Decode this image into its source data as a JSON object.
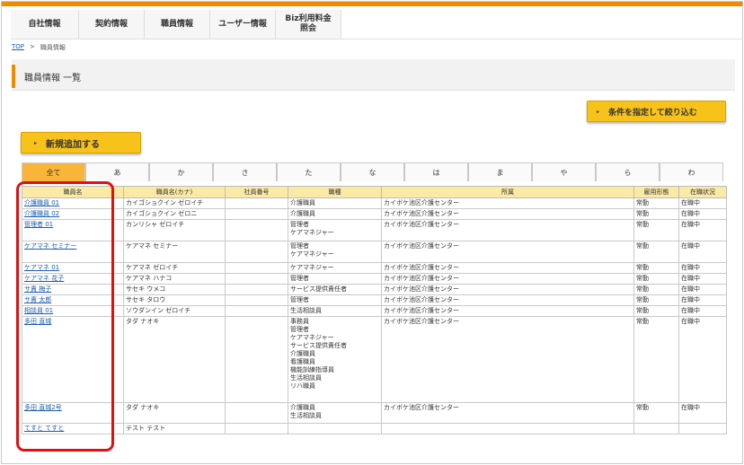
{
  "nav": {
    "tabs": [
      {
        "label": "自社情報"
      },
      {
        "label": "契約情報"
      },
      {
        "label": "職員情報"
      },
      {
        "label": "ユーザー情報"
      },
      {
        "label": "Biz利用料金\n照会"
      }
    ]
  },
  "breadcrumb": {
    "top": "TOP",
    "separator": ">",
    "current": "職員情報"
  },
  "page": {
    "title": "職員情報 一覧"
  },
  "buttons": {
    "filter": "条件を指定して絞り込む",
    "add": "新規追加する"
  },
  "kana_tabs": [
    "全て",
    "あ",
    "か",
    "さ",
    "た",
    "な",
    "は",
    "ま",
    "や",
    "ら",
    "わ"
  ],
  "table": {
    "headers": [
      "職員名",
      "職員名(カナ)",
      "社員番号",
      "職種",
      "所属",
      "雇用形態",
      "在職状況"
    ],
    "rows": [
      {
        "name": "介護職員 01",
        "kana": "カイゴショクイン ゼロイチ",
        "no": "",
        "jobs": [
          "介護職員"
        ],
        "dept": "カイボケ池区介護センター",
        "emp": "常勤",
        "status": "在職中"
      },
      {
        "name": "介護職員 02",
        "kana": "カイゴショクイン ゼロニ",
        "no": "",
        "jobs": [
          "介護職員"
        ],
        "dept": "カイボケ池区介護センター",
        "emp": "常勤",
        "status": "在職中"
      },
      {
        "name": "管理者 01",
        "kana": "カンリシャ ゼロイチ",
        "no": "",
        "jobs": [
          "管理者",
          "ケアマネジャー"
        ],
        "dept": "カイボケ池区介護センター",
        "emp": "常勤",
        "status": "在職中"
      },
      {
        "name": "ケアマネ セミナー",
        "kana": "ケアマネ セミナー",
        "no": "",
        "jobs": [
          "管理者",
          "ケアマネジャー"
        ],
        "dept": "カイボケ池区介護センター",
        "emp": "常勤",
        "status": "在職中"
      },
      {
        "name": "ケアマネ 01",
        "kana": "ケアマネ ゼロイチ",
        "no": "",
        "jobs": [
          "ケアマネジャー"
        ],
        "dept": "カイボケ池区介護センター",
        "emp": "常勤",
        "status": "在職中"
      },
      {
        "name": "ケアマネ 花子",
        "kana": "ケアマネ ハナコ",
        "no": "",
        "jobs": [
          "管理者"
        ],
        "dept": "カイボケ池区介護センター",
        "emp": "常勤",
        "status": "在職中"
      },
      {
        "name": "サ責 梅子",
        "kana": "サセキ ウメコ",
        "no": "",
        "jobs": [
          "サービス提供責任者"
        ],
        "dept": "カイボケ池区介護センター",
        "emp": "常勤",
        "status": "在職中"
      },
      {
        "name": "サ責 太郎",
        "kana": "サセキ タロウ",
        "no": "",
        "jobs": [
          "管理者"
        ],
        "dept": "カイボケ池区介護センター",
        "emp": "常勤",
        "status": "在職中"
      },
      {
        "name": "相談員 01",
        "kana": "ソウダンイン ゼロイチ",
        "no": "",
        "jobs": [
          "生活相談員"
        ],
        "dept": "カイボケ池区介護センター",
        "emp": "常勤",
        "status": "在職中"
      },
      {
        "name": "多田 直城",
        "kana": "タダ ナオキ",
        "no": "",
        "jobs": [
          "事務員",
          "管理者",
          "ケアマネジャー",
          "サービス提供責任者",
          "介護職員",
          "看護職員",
          "機能訓練指導員",
          "生活相談員",
          "リハ職員"
        ],
        "dept": "カイボケ池区介護センター",
        "emp": "常勤",
        "status": "在職中"
      },
      {
        "name": "多田 直城2号",
        "kana": "タダ ナオキ",
        "no": "",
        "jobs": [
          "介護職員",
          "生活相談員"
        ],
        "dept": "カイボケ池区介護センター",
        "emp": "常勤",
        "status": "在職中"
      },
      {
        "name": "てすと てすと",
        "kana": "テスト テスト",
        "no": "",
        "jobs": [],
        "dept": "",
        "emp": "",
        "status": ""
      }
    ]
  }
}
